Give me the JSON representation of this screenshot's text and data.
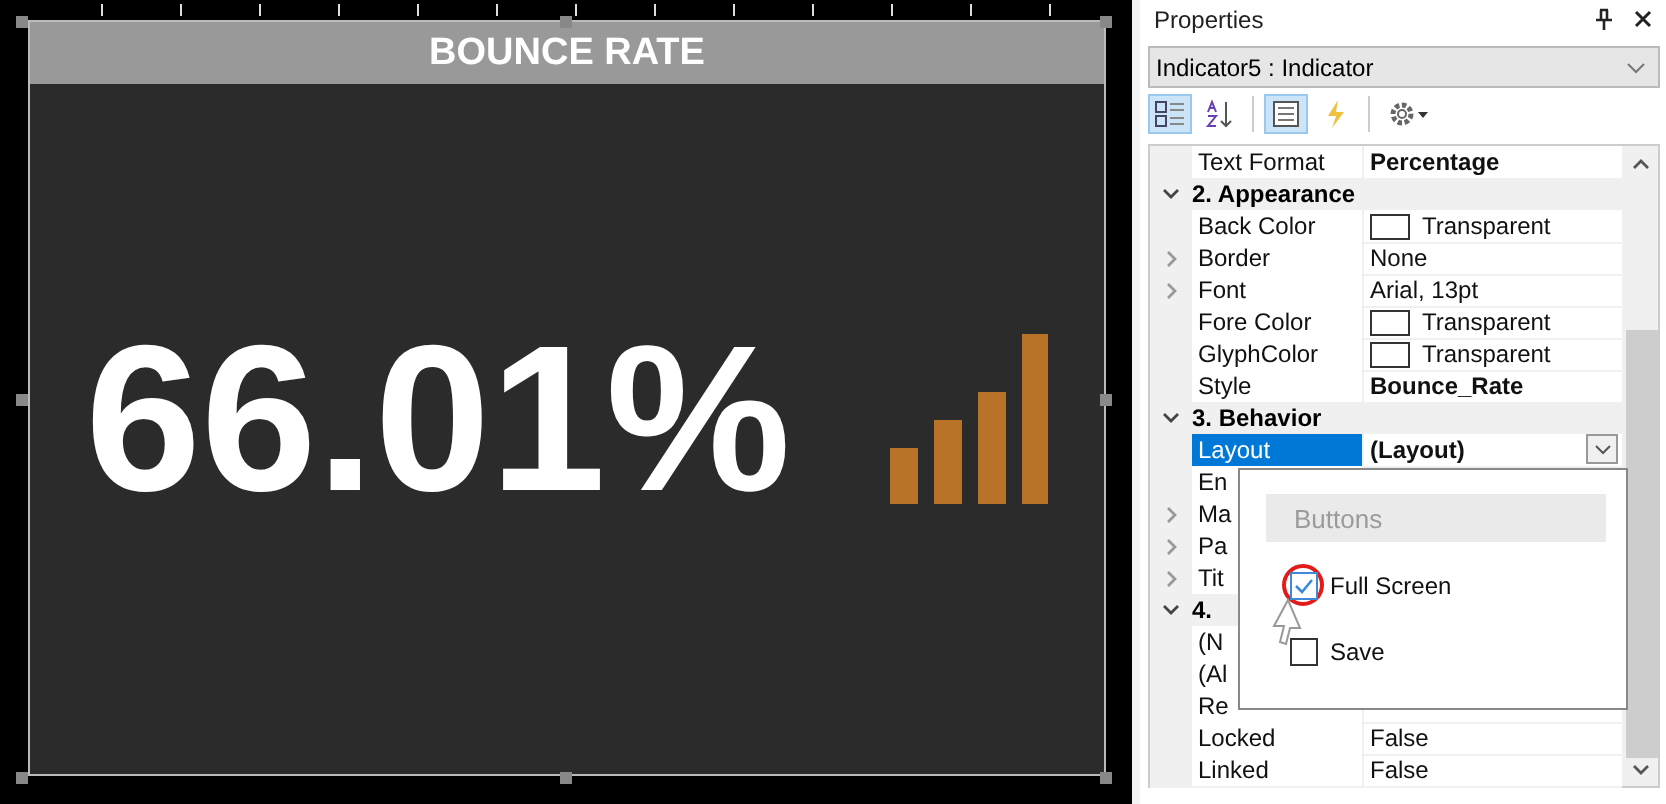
{
  "canvas": {
    "indicator": {
      "title": "BOUNCE RATE",
      "value": "66.01%"
    }
  },
  "properties": {
    "title": "Properties",
    "object_selector": "Indicator5 : Indicator",
    "toolbar": [
      {
        "kind": "categorized",
        "selected": true
      },
      {
        "kind": "alphabetical",
        "selected": false
      },
      {
        "kind": "properties",
        "selected": true
      },
      {
        "kind": "events",
        "selected": false
      },
      {
        "kind": "settings",
        "selected": false
      }
    ],
    "rows": [
      {
        "kind": "property",
        "name": "Text Format",
        "value": "Percentage",
        "emphasized": true,
        "expandable": false,
        "swatch": false,
        "selected": false
      },
      {
        "kind": "category",
        "name": "2. Appearance",
        "expanded": true
      },
      {
        "kind": "property",
        "name": "Back Color",
        "value": "Transparent",
        "emphasized": false,
        "expandable": false,
        "swatch": true,
        "selected": false
      },
      {
        "kind": "property",
        "name": "Border",
        "value": "None",
        "emphasized": false,
        "expandable": true,
        "swatch": false,
        "selected": false
      },
      {
        "kind": "property",
        "name": "Font",
        "value": "Arial, 13pt",
        "emphasized": false,
        "expandable": true,
        "swatch": false,
        "selected": false
      },
      {
        "kind": "property",
        "name": "Fore Color",
        "value": "Transparent",
        "emphasized": false,
        "expandable": false,
        "swatch": true,
        "selected": false
      },
      {
        "kind": "property",
        "name": "GlyphColor",
        "value": "Transparent",
        "emphasized": false,
        "expandable": false,
        "swatch": true,
        "selected": false
      },
      {
        "kind": "property",
        "name": "Style",
        "value": "Bounce_Rate",
        "emphasized": true,
        "expandable": false,
        "swatch": false,
        "selected": false
      },
      {
        "kind": "category",
        "name": "3. Behavior",
        "expanded": true
      },
      {
        "kind": "property",
        "name": "Layout",
        "value": "(Layout)",
        "emphasized": true,
        "expandable": false,
        "swatch": false,
        "selected": true,
        "dropdown": true
      },
      {
        "kind": "property",
        "name": "En",
        "expandable": false,
        "selected": false
      },
      {
        "kind": "property",
        "name": "Ma",
        "expandable": true,
        "selected": false
      },
      {
        "kind": "property",
        "name": "Pa",
        "expandable": true,
        "selected": false
      },
      {
        "kind": "property",
        "name": "Tit",
        "expandable": true,
        "selected": false
      },
      {
        "kind": "category",
        "name": "4.",
        "expanded": true
      },
      {
        "kind": "property",
        "name": "(N",
        "expandable": false,
        "selected": false
      },
      {
        "kind": "property",
        "name": "(Al",
        "expandable": false,
        "selected": false
      },
      {
        "kind": "property",
        "name": "Re",
        "expandable": false,
        "selected": false
      },
      {
        "kind": "property",
        "name": "Locked",
        "value": "False",
        "emphasized": false,
        "expandable": false,
        "swatch": false,
        "selected": false
      },
      {
        "kind": "property",
        "name": "Linked",
        "value": "False",
        "emphasized": false,
        "expandable": false,
        "swatch": false,
        "selected": false
      }
    ],
    "popup": {
      "header": "Buttons",
      "options": [
        {
          "label": "Full Screen",
          "checked": true,
          "highlighted": true
        },
        {
          "label": "Save",
          "checked": false,
          "highlighted": false
        }
      ]
    }
  }
}
